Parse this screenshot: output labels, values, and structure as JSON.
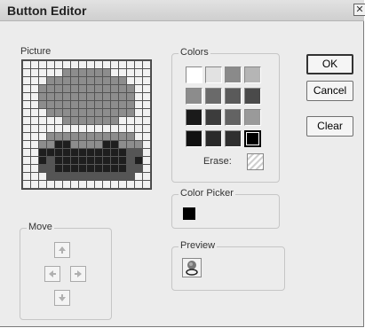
{
  "window": {
    "title": "Button Editor",
    "close_glyph": "✕"
  },
  "labels": {
    "picture": "Picture",
    "colors": "Colors",
    "erase": "Erase:",
    "color_picker": "Color Picker",
    "preview": "Preview",
    "move": "Move"
  },
  "buttons": {
    "ok": "OK",
    "cancel": "Cancel",
    "clear": "Clear"
  },
  "palette": {
    "colors": [
      "#ffffff",
      "#e2e2e2",
      "#8a8a8a",
      "#b5b5b5",
      "#8c8c8c",
      "#6a6a6a",
      "#5a5a5a",
      "#4a4a4a",
      "#1a1a1a",
      "#3c3c3c",
      "#636363",
      "#9a9a9a",
      "#111111",
      "#2a2a2a",
      "#2f2f2f",
      "#000000"
    ],
    "selected_index": 15
  },
  "current_color": "#000000",
  "pixel_art": [
    "aaaaaaaaaaaaaaaa",
    "aaaaabbbbbbaaaaa",
    "aaabbbbbbbbbbaaa",
    "aabbbbbbbbbbbbaa",
    "aabbbbbbbbbbbbaa",
    "aabbbbbbbbbbbbaa",
    "aaabbbbbbbbbbbaa",
    "aaaaabbbbbbbaaaa",
    "aaaaaaaaaaaaaaaa",
    "aaabbbbbbbbbbbaa",
    "aabbddbbbbddbbba",
    "aadddddddddddeea",
    "aadedddddddddeda",
    "aaeedddddddddeea",
    "aaaeeeeeeeeeeeaa",
    "aaaaaaaaaaaaaaaa"
  ],
  "pixel_colors": {
    "a": "#f2f2f2",
    "b": "#8d8d8d",
    "c": "#aaaaaa",
    "d": "#1e1e1e",
    "e": "#555555"
  },
  "icons": {
    "move_up": "arrow-up-icon",
    "move_down": "arrow-down-icon",
    "move_left": "arrow-left-icon",
    "move_right": "arrow-right-icon",
    "preview": "button-preview-icon"
  }
}
